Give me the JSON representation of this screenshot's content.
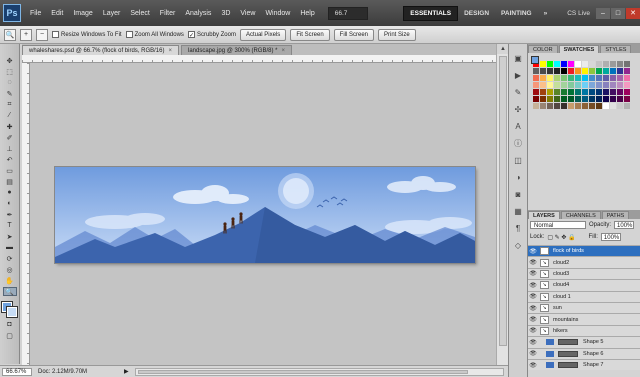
{
  "app": {
    "logo": "Ps",
    "menu": [
      "File",
      "Edit",
      "Image",
      "Layer",
      "Select",
      "Filter",
      "Analysis",
      "3D",
      "View",
      "Window",
      "Help"
    ],
    "zoom": "66.7",
    "workspaces": [
      "ESSENTIALS",
      "DESIGN",
      "PAINTING",
      "»"
    ],
    "cs_live": "CS Live",
    "window_controls": [
      "–",
      "□",
      "✕"
    ]
  },
  "options_bar": {
    "resize_windows": "Resize Windows To Fit",
    "zoom_all": "Zoom All Windows",
    "scrubby": "Scrubby Zoom",
    "actual_pixels": "Actual Pixels",
    "fit_screen": "Fit Screen",
    "fill_screen": "Fill Screen",
    "print_size": "Print Size"
  },
  "tabs": [
    {
      "label": "whaleshares.psd @ 66.7% (flock of birds, RGB/16)"
    },
    {
      "label": "landscape.jpg @ 300% (RGB/8) *"
    }
  ],
  "status": {
    "zoom": "66.67%",
    "doc": "Doc: 2.12M/9.70M"
  },
  "panels": {
    "swatch_tabs": [
      "COLOR",
      "SWATCHES",
      "STYLES"
    ],
    "layer_tabs": [
      "LAYERS",
      "CHANNELS",
      "PATHS"
    ],
    "blend_mode": "Normal",
    "opacity_label": "Opacity:",
    "opacity_value": "100%",
    "lock_label": "Lock:",
    "fill_label": "Fill:",
    "fill_value": "100%"
  },
  "layers": [
    {
      "name": "flock of birds",
      "selected": true
    },
    {
      "name": "cloud2"
    },
    {
      "name": "cloud3"
    },
    {
      "name": "cloud4"
    },
    {
      "name": "cloud 1"
    },
    {
      "name": "sun"
    },
    {
      "name": "mountains"
    },
    {
      "name": "hikers"
    },
    {
      "name": "Shape 5"
    },
    {
      "name": "Shape 6"
    },
    {
      "name": "Shape 7"
    }
  ],
  "colors": {
    "accent": "#2d6fbf",
    "sky_top": "#6f9bde",
    "sky_bottom": "#c8dbf6",
    "mountain_dark": "#3c64ad"
  }
}
